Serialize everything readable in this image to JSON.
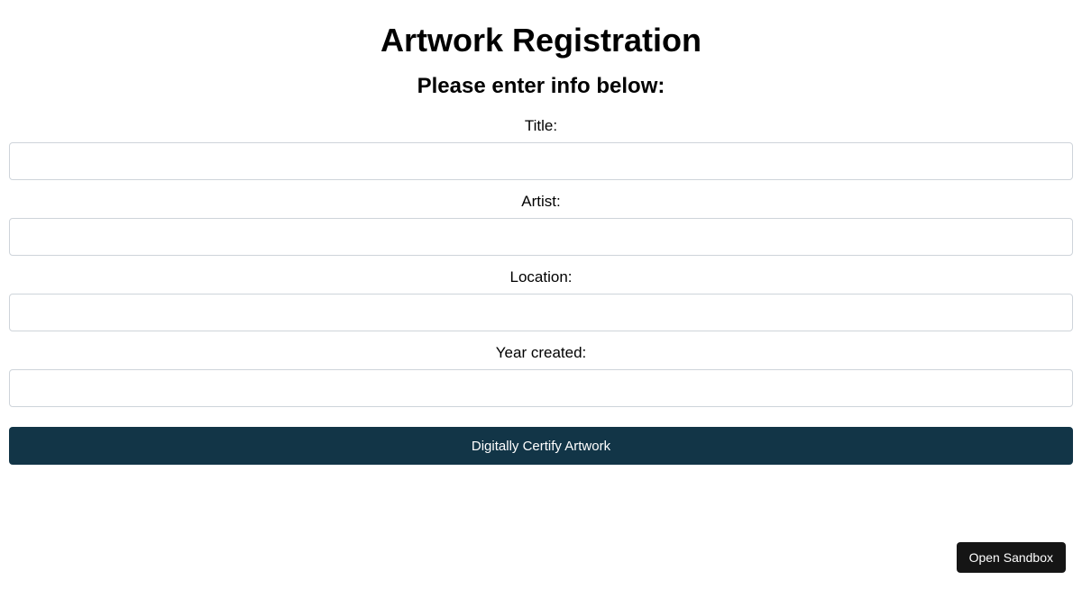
{
  "header": {
    "title": "Artwork Registration",
    "subtitle": "Please enter info below:"
  },
  "form": {
    "fields": [
      {
        "label": "Title:",
        "value": ""
      },
      {
        "label": "Artist:",
        "value": ""
      },
      {
        "label": "Location:",
        "value": ""
      },
      {
        "label": "Year created:",
        "value": ""
      }
    ],
    "submit_label": "Digitally Certify Artwork"
  },
  "sandbox": {
    "label": "Open Sandbox"
  }
}
